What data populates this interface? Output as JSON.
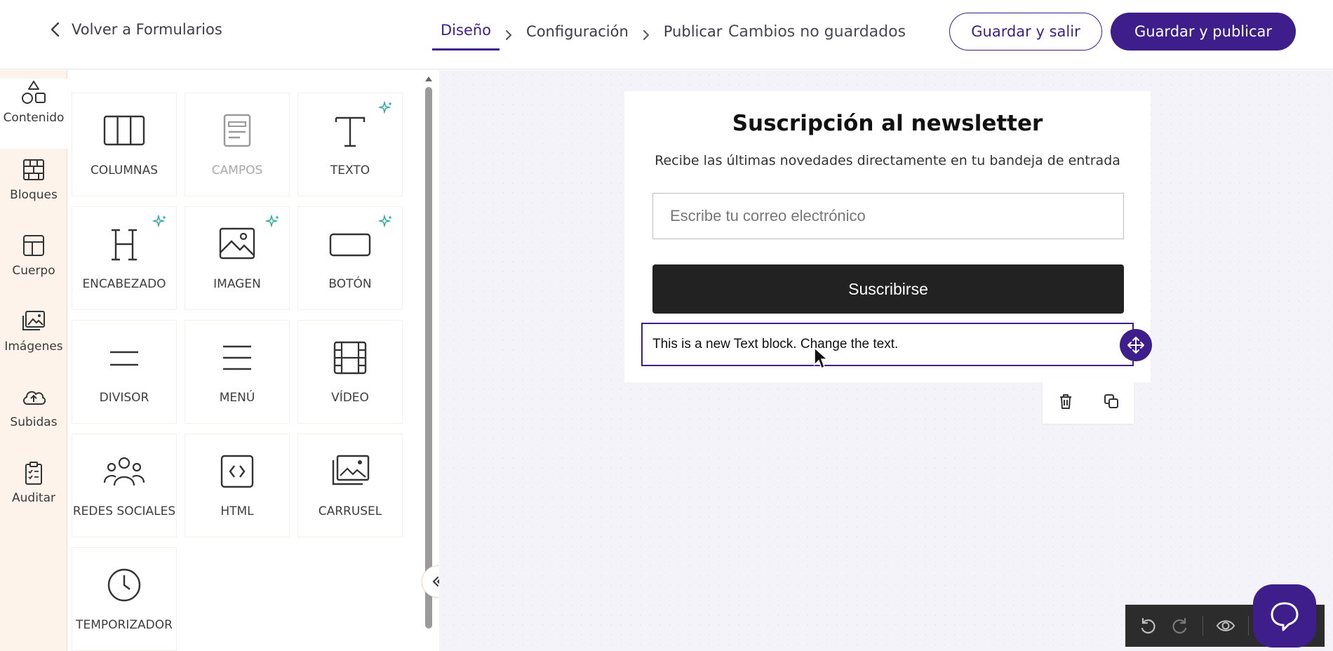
{
  "header": {
    "back_label": "Volver a Formularios",
    "steps": [
      {
        "label": "Diseño",
        "active": true
      },
      {
        "label": "Configuración",
        "active": false
      },
      {
        "label": "Publicar",
        "active": false
      }
    ],
    "unsaved_label": "Cambios no guardados",
    "save_exit_label": "Guardar y salir",
    "save_publish_label": "Guardar y publicar"
  },
  "sidebar": {
    "items": [
      {
        "label": "Contenido",
        "icon": "shapes-icon",
        "active": true
      },
      {
        "label": "Bloques",
        "icon": "bricks-icon"
      },
      {
        "label": "Cuerpo",
        "icon": "layout-icon"
      },
      {
        "label": "Imágenes",
        "icon": "images-icon"
      },
      {
        "label": "Subidas",
        "icon": "cloud-upload-icon"
      },
      {
        "label": "Auditar",
        "icon": "clipboard-check-icon"
      }
    ]
  },
  "content_tiles": [
    {
      "label": "COLUMNAS",
      "icon": "columns-icon"
    },
    {
      "label": "CAMPOS",
      "icon": "fields-icon",
      "disabled": true
    },
    {
      "label": "TEXTO",
      "icon": "text-icon",
      "ai": true
    },
    {
      "label": "ENCABEZADO",
      "icon": "heading-icon",
      "ai": true
    },
    {
      "label": "IMAGEN",
      "icon": "image-icon",
      "ai": true
    },
    {
      "label": "BOTÓN",
      "icon": "button-icon",
      "ai": true
    },
    {
      "label": "DIVISOR",
      "icon": "divider-icon"
    },
    {
      "label": "MENÚ",
      "icon": "menu-icon"
    },
    {
      "label": "VÍDEO",
      "icon": "video-icon"
    },
    {
      "label": "REDES SOCIALES",
      "icon": "social-icon"
    },
    {
      "label": "HTML",
      "icon": "html-icon"
    },
    {
      "label": "CARRUSEL",
      "icon": "carousel-icon"
    },
    {
      "label": "TEMPORIZADOR",
      "icon": "timer-icon"
    }
  ],
  "form": {
    "title": "Suscripción al newsletter",
    "subtitle": "Recibe las últimas novedades directamente en tu bandeja de entrada",
    "email_placeholder": "Escribe tu correo electrónico",
    "subscribe_label": "Suscribirse",
    "text_block": "This is a new Text block. Change the text."
  },
  "colors": {
    "accent": "#3d1e8a",
    "nav_bg": "#fdf3ea",
    "canvas_bg": "#f4f3fa",
    "ai_sparkle": "#2aa79b"
  }
}
